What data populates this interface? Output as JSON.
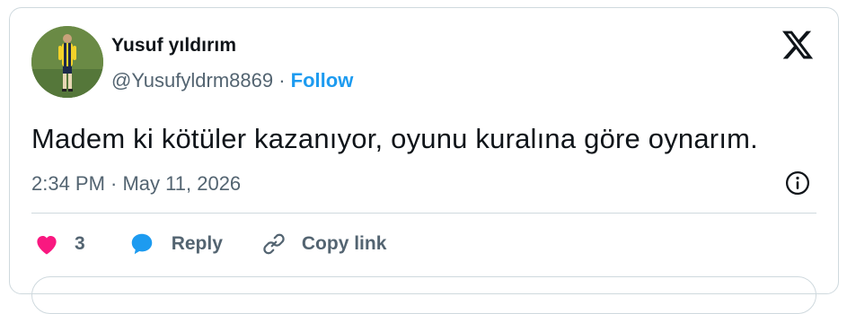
{
  "author": {
    "display_name": "Yusuf yıldırım",
    "handle": "@Yusufyldrm8869",
    "separator": "·",
    "follow_label": "Follow"
  },
  "tweet": {
    "text": "Madem ki kötüler kazanıyor, oyunu kuralına göre oynarım.",
    "timestamp": "2:34 PM · May 11, 2026"
  },
  "actions": {
    "like_count": "3",
    "reply_label": "Reply",
    "copy_link_label": "Copy link"
  },
  "icons": {
    "brand": "x-logo-icon",
    "info": "info-icon",
    "like": "heart-icon",
    "reply": "reply-bubble-icon",
    "copy": "link-icon"
  },
  "colors": {
    "accent": "#1d9bf0",
    "like": "#f91880",
    "text": "#0f1419",
    "muted": "#536471",
    "border": "#cfd9de"
  }
}
